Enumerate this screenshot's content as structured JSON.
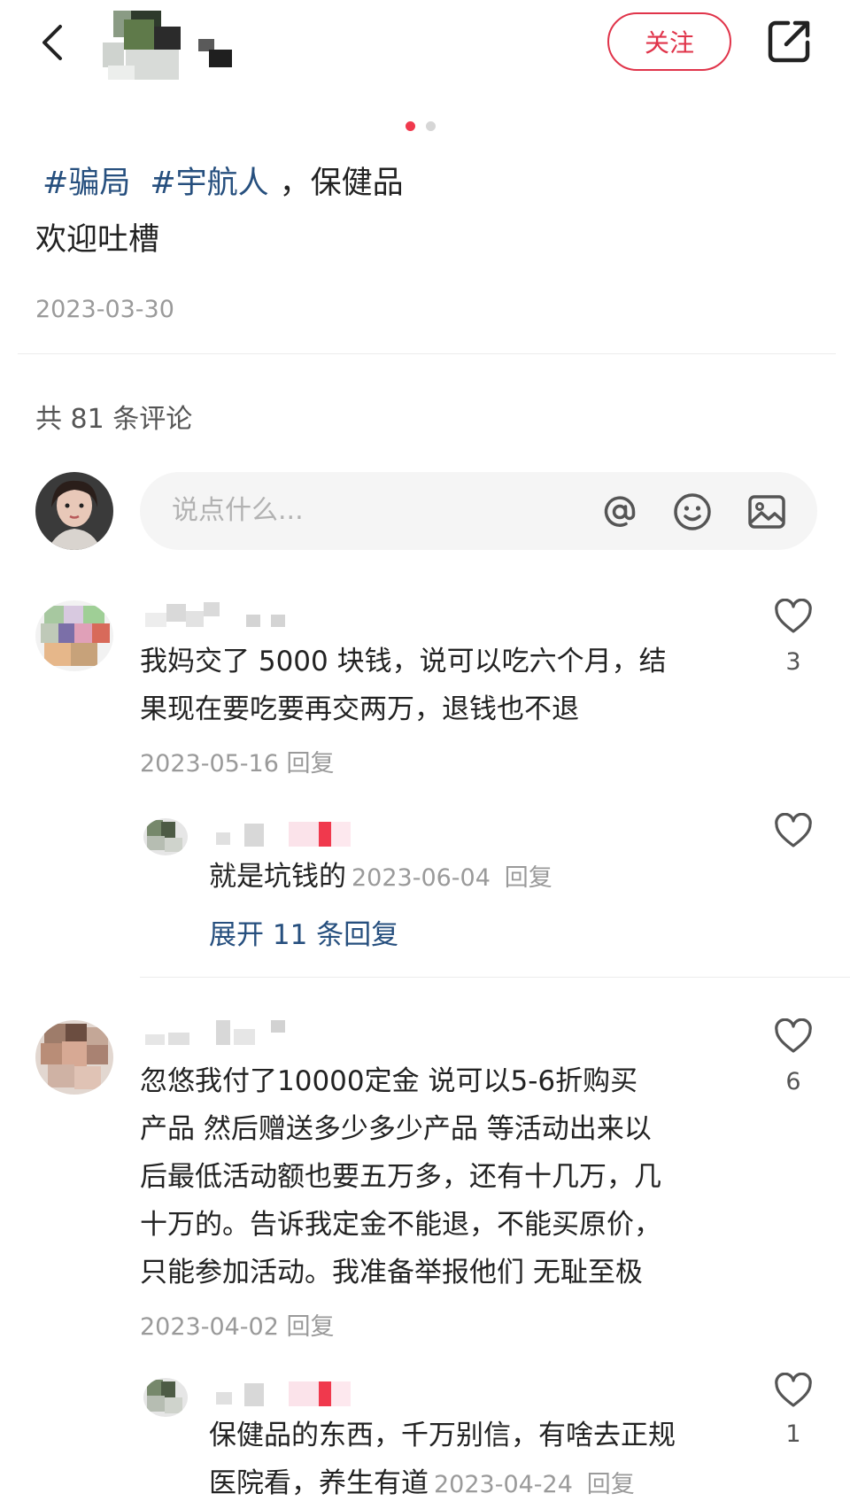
{
  "header": {
    "follow_label": "关注"
  },
  "post": {
    "tags": [
      "#骗局",
      "#宇航人"
    ],
    "line1_rest": "，保健品",
    "line2": "欢迎吐槽",
    "date": "2023-03-30"
  },
  "pager": {
    "total": 2,
    "active": 1
  },
  "comments_header": "共 81 条评论",
  "input": {
    "placeholder": "说点什么..."
  },
  "comments": [
    {
      "text_lines": [
        "我妈交了 5000 块钱，说可以吃六个月，结",
        "果现在要吃要再交两万，退钱也不退"
      ],
      "date": "2023-05-16",
      "reply_label": "回复",
      "likes": "3",
      "replies": [
        {
          "text": "就是坑钱的",
          "date": "2023-06-04",
          "reply_label": "回复",
          "likes": ""
        }
      ],
      "expand_label": "展开 11 条回复"
    },
    {
      "text_lines": [
        "忽悠我付了10000定金 说可以5-6折购买",
        "产品 然后赠送多少多少产品 等活动出来以",
        "后最低活动额也要五万多，还有十几万，几",
        "十万的。告诉我定金不能退，不能买原价，",
        "只能参加活动。我准备举报他们 无耻至极"
      ],
      "date": "2023-04-02",
      "reply_label": "回复",
      "likes": "6",
      "replies": [
        {
          "text_lines": [
            "保健品的东西，千万别信，有啥去正规",
            "医院看，养生有道"
          ],
          "date": "2023-04-24",
          "reply_label": "回复",
          "likes": "1"
        }
      ]
    }
  ],
  "colors": {
    "accent": "#e0344a",
    "tag": "#264f7e",
    "muted": "#9a9a9a"
  }
}
